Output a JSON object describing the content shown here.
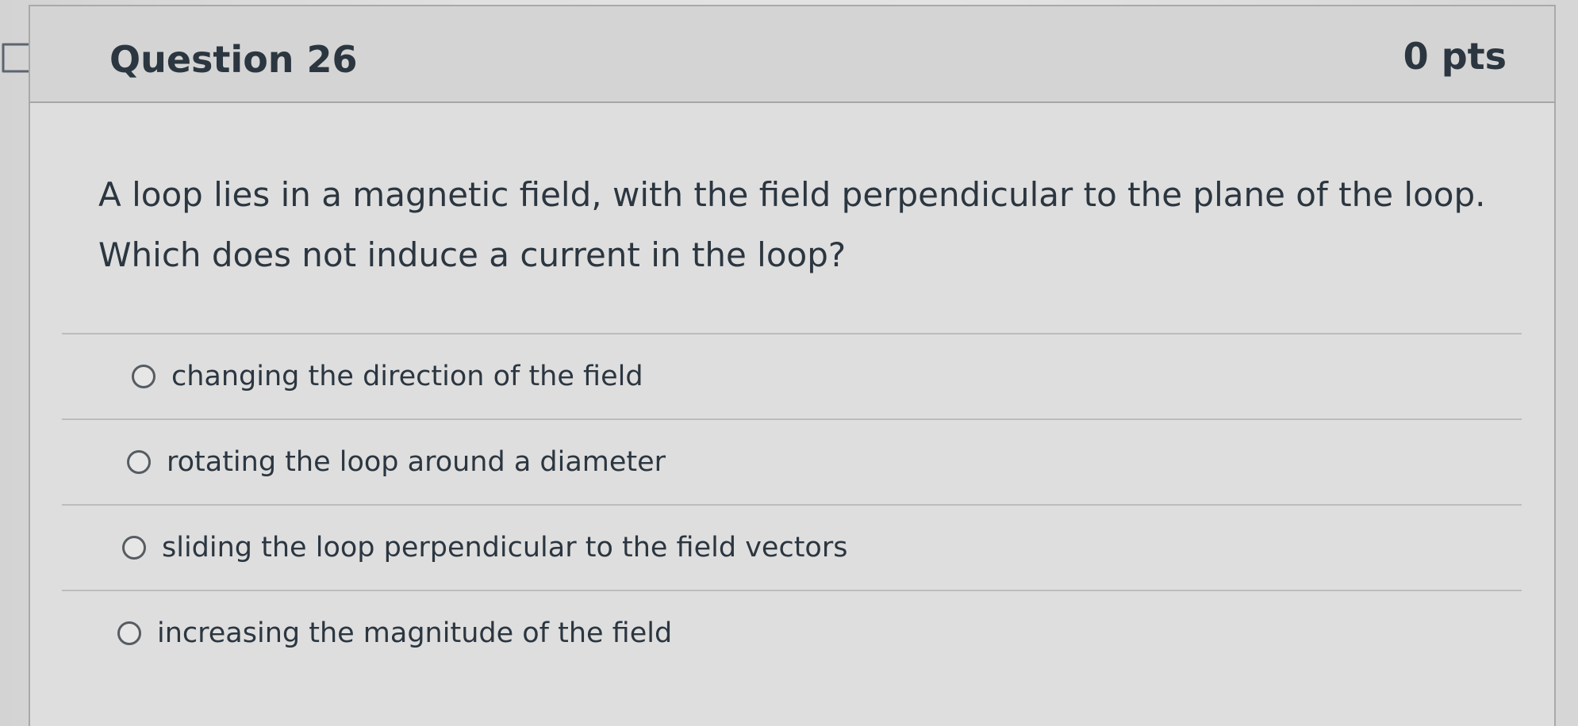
{
  "question": {
    "title": "Question 26",
    "points": "0 pts",
    "text": "A loop lies in a magnetic field, with the field perpendicular to the plane of the loop. Which does not induce a current in the loop?",
    "answers": [
      {
        "label": "changing the direction of the field"
      },
      {
        "label": "rotating the loop around a diameter"
      },
      {
        "label": "sliding the loop perpendicular to the field vectors"
      },
      {
        "label": "increasing the magnitude of the field"
      }
    ]
  },
  "icons": {
    "flag": "flag-question-icon",
    "radio": "radio-unchecked-icon"
  },
  "colors": {
    "text": "#2b3640",
    "header_bg": "#d4d4d4",
    "card_bg": "#dedede",
    "border": "#a9a9a9"
  }
}
